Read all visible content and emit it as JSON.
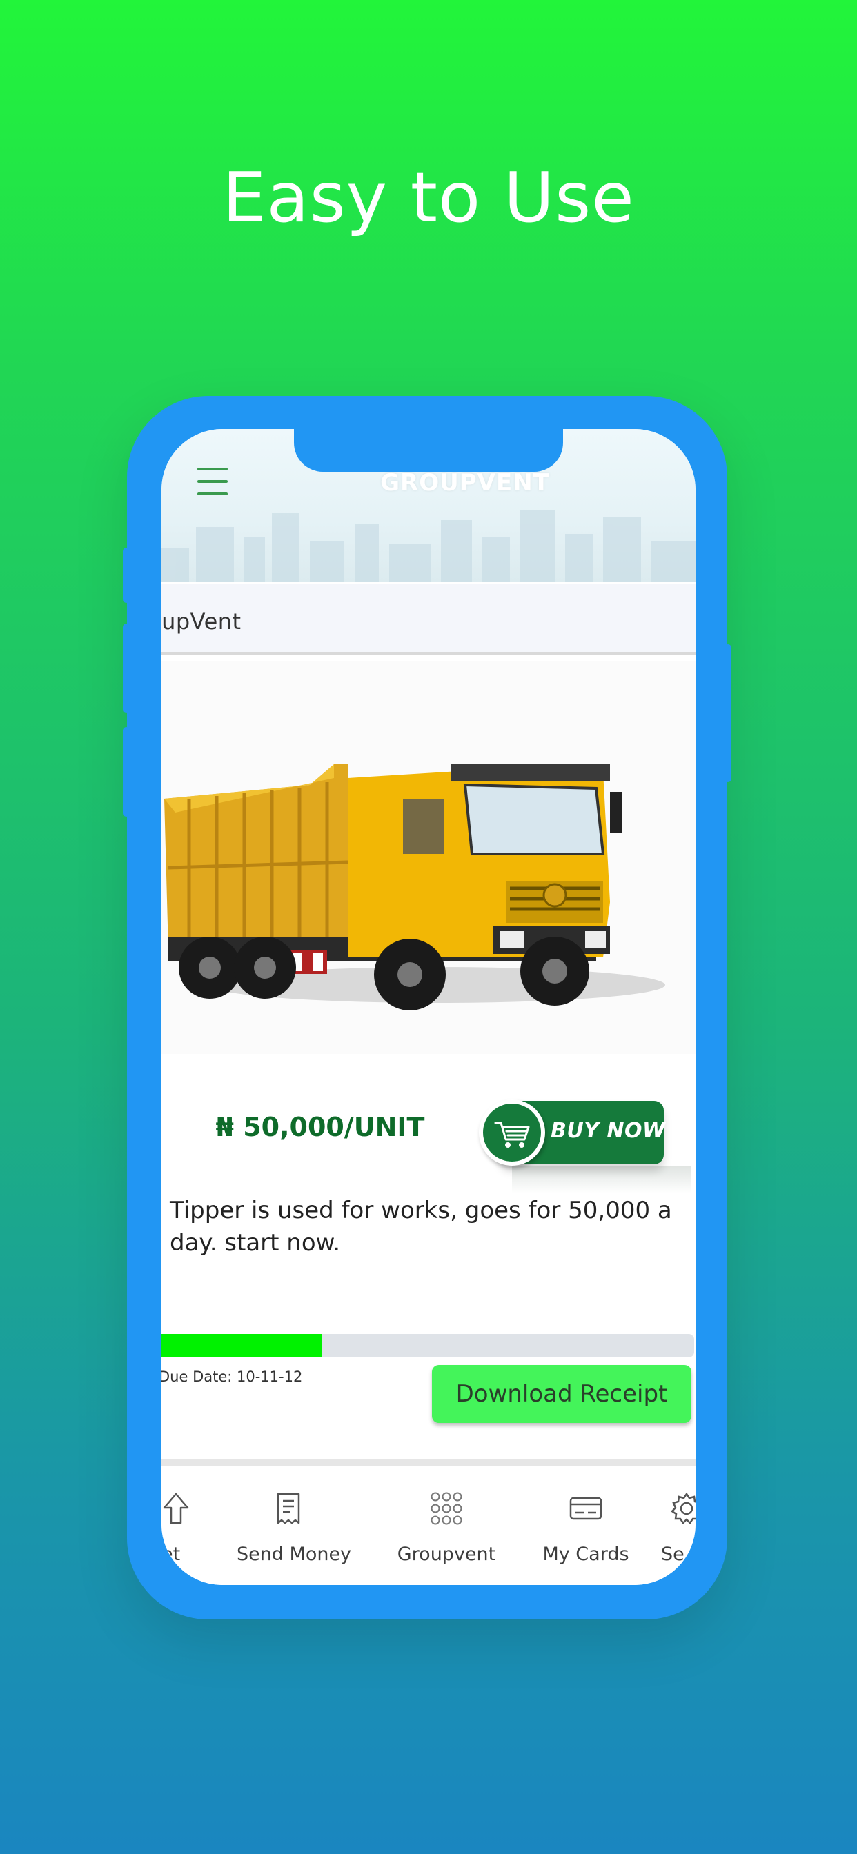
{
  "headline": "Easy to Use",
  "app": {
    "brand": "GROUPVENT",
    "section_title": "oupVent"
  },
  "product": {
    "image": "yellow-tipper-truck",
    "price": "₦ 50,000/UNIT",
    "buy_label": "BUY NOW",
    "description": "Tipper is used for works, goes for 50,000 a day. start now.",
    "progress_fraction": 0.3,
    "due_date": "Due Date: 10-11-12",
    "receipt_label": "Download Receipt"
  },
  "nav": {
    "items": [
      {
        "label": "et",
        "icon": "up-arrow-icon"
      },
      {
        "label": "Send Money",
        "icon": "receipt-icon"
      },
      {
        "label": "Groupvent",
        "icon": "grid-icon"
      },
      {
        "label": "My Cards",
        "icon": "card-icon"
      },
      {
        "label": "Se",
        "icon": "gear-icon"
      }
    ]
  },
  "colors": {
    "phone_frame": "#2196f3",
    "accent_green": "#157a3b",
    "progress": "#00f200",
    "receipt_button": "#44f45a"
  }
}
